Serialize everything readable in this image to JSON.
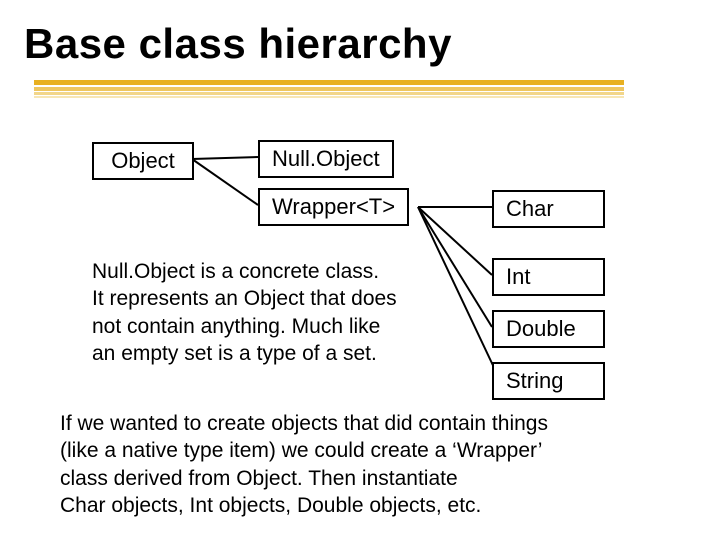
{
  "title": "Base class hierarchy",
  "boxes": {
    "object": "Object",
    "nullobject": "Null.Object",
    "wrapper": "Wrapper<T>",
    "char": "Char",
    "int": "Int",
    "double": "Double",
    "string": "String"
  },
  "paragraph_mid": {
    "l1": "Null.Object is a concrete class.",
    "l2": "It represents an Object that does",
    "l3": "not contain anything.  Much like",
    "l4": "an empty set is a type of a set."
  },
  "paragraph_bot": {
    "l1": "If we wanted to create objects that did contain things",
    "l2": "(like a native type item) we could create a ‘Wrapper’",
    "l3": "class derived from Object.  Then instantiate",
    "l4": "Char objects, Int objects, Double objects, etc."
  }
}
